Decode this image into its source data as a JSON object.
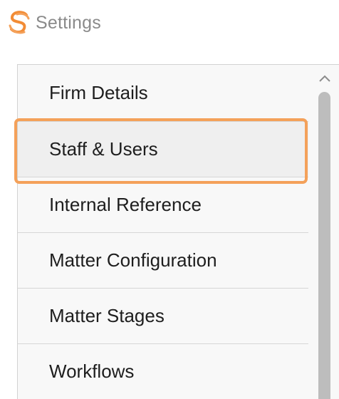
{
  "header": {
    "logo_icon": "swirl-s-logo-icon",
    "title": "Settings"
  },
  "colors": {
    "brand_accent": "#f4a15a",
    "highlight_border": "#f4a15a",
    "title_text": "#8a8a8a"
  },
  "settings_menu": {
    "selected_index": 1,
    "items": [
      {
        "label": "Firm Details"
      },
      {
        "label": "Staff & Users"
      },
      {
        "label": "Internal Reference"
      },
      {
        "label": "Matter Configuration"
      },
      {
        "label": "Matter Stages"
      },
      {
        "label": "Workflows"
      }
    ]
  },
  "scrollbar": {
    "up_icon": "chevron-up-icon"
  }
}
